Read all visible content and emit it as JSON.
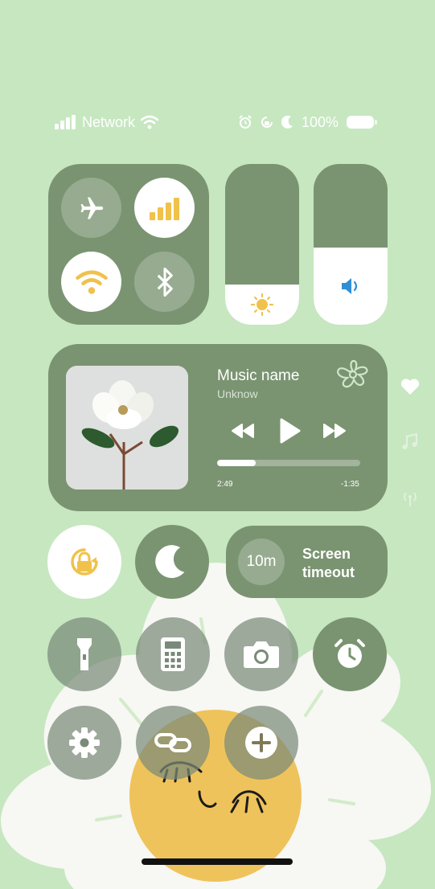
{
  "status_bar": {
    "network_label": "Network",
    "battery_percent": "100%",
    "icons": [
      "signal-icon",
      "wifi-icon",
      "alarm-icon",
      "rotation-lock-icon",
      "moon-icon",
      "battery-icon"
    ]
  },
  "connectivity": {
    "airplane": {
      "icon": "airplane-icon",
      "active": false
    },
    "mobile_data": {
      "icon": "signal-bars-icon",
      "active": true
    },
    "wifi": {
      "icon": "wifi-icon",
      "active": true
    },
    "bluetooth": {
      "icon": "bluetooth-icon",
      "active": false
    }
  },
  "brightness": {
    "icon": "sun-icon",
    "level": 0.25
  },
  "volume": {
    "icon": "speaker-icon",
    "level": 0.48
  },
  "music": {
    "title": "Music name",
    "artist": "Unknow",
    "elapsed": "2:49",
    "remaining": "-1:35",
    "progress": 0.27,
    "controls": [
      "rewind-icon",
      "play-icon",
      "fast-forward-icon"
    ]
  },
  "toggles": {
    "rotation_lock": {
      "icon": "rotation-lock-icon",
      "active": true
    },
    "do_not_disturb": {
      "icon": "moon-icon",
      "active": false
    }
  },
  "screen_timeout": {
    "value": "10m",
    "label_line1": "Screen",
    "label_line2": "timeout"
  },
  "shortcuts": [
    "flashlight-icon",
    "calculator-icon",
    "camera-icon",
    "alarm-clock-icon",
    "settings-icon",
    "link-icon",
    "add-icon"
  ],
  "side_icons": [
    "heart-icon",
    "music-note-icon",
    "broadcast-icon"
  ],
  "colors": {
    "background": "#c6e7c0",
    "panel": "#7a9471",
    "accent_yellow": "#f0c24b",
    "accent_blue": "#2f8fd6"
  }
}
